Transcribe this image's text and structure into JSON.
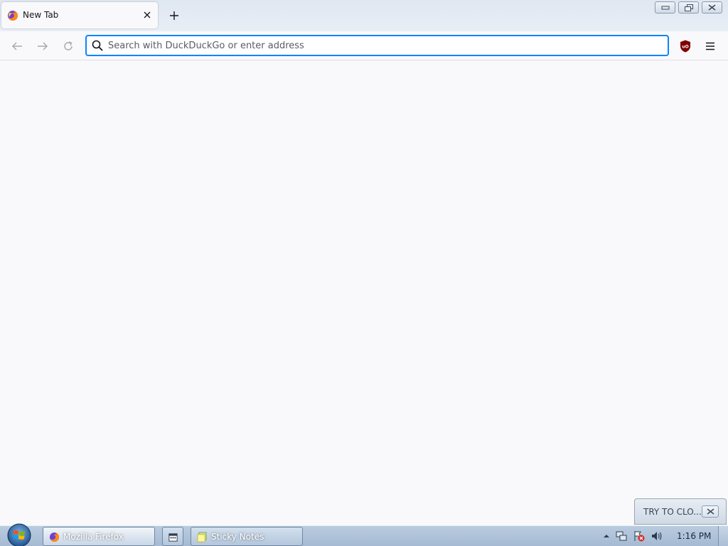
{
  "browser": {
    "tab": {
      "title": "New Tab",
      "favicon": "firefox-icon",
      "close_icon": "close-icon"
    },
    "new_tab_icon": "plus-icon",
    "window_controls": [
      "minimize-icon",
      "restore-icon",
      "close-icon"
    ],
    "nav": {
      "back_icon": "arrow-left-icon",
      "forward_icon": "arrow-right-icon",
      "reload_icon": "reload-icon"
    },
    "urlbar": {
      "placeholder": "Search with DuckDuckGo or enter address",
      "value": "",
      "focus_color": "#0a84ff"
    },
    "extensions": [
      "ublock-origin-icon"
    ],
    "menu_icon": "hamburger-menu-icon"
  },
  "popup": {
    "label": "TRY TO CLO..."
  },
  "taskbar": {
    "start_icon": "windows-start-orb",
    "items": [
      {
        "label": "Mozilla Firefox",
        "icon": "firefox-icon",
        "active": true
      },
      {
        "label": "",
        "icon": "calendar-icon",
        "active": false
      },
      {
        "label": "Sticky Notes",
        "icon": "sticky-notes-icon",
        "active": false
      }
    ],
    "tray_icons": [
      "show-hidden-icons-arrow",
      "network-icon",
      "action-center-error-icon",
      "volume-icon"
    ],
    "clock": "1:16 PM"
  }
}
